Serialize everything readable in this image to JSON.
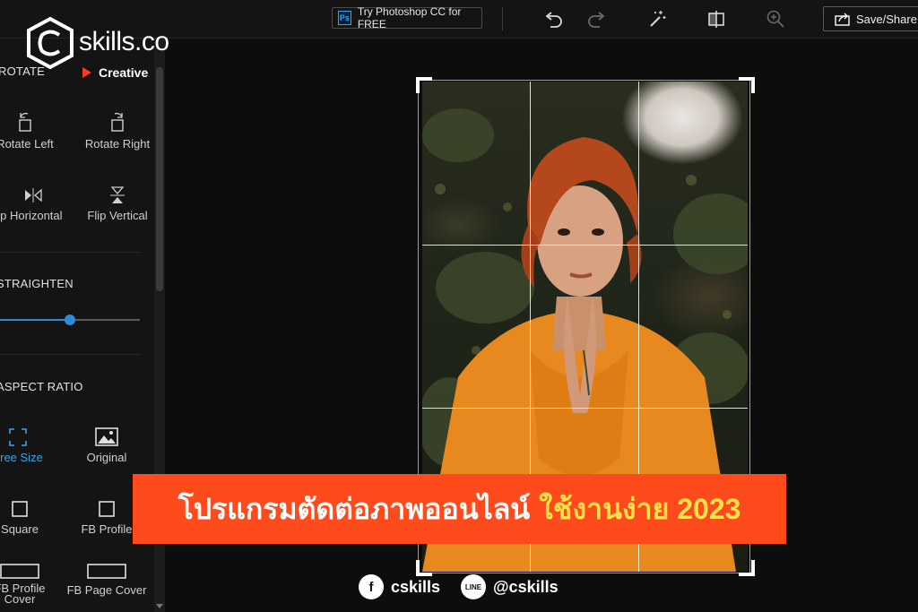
{
  "toolbar": {
    "ps_badge": "Ps",
    "try_photoshop_label": "Try Photoshop CC for FREE",
    "save_label": "Save/Share",
    "icons": [
      "undo-icon",
      "redo-icon",
      "magic-wand-icon",
      "compare-icon",
      "zoom-icon"
    ]
  },
  "brand": {
    "name": "skills.co",
    "sub": "Creative"
  },
  "sidebar": {
    "rotate_title": "ROTATE",
    "rotate_left": "Rotate Left",
    "rotate_right": "Rotate Right",
    "flip_horizontal": "Flip Horizontal",
    "flip_vertical": "Flip Vertical",
    "straighten_title": "STRAIGHTEN",
    "straighten_level": 0.5,
    "aspect_title": "ASPECT RATIO",
    "aspect_items": {
      "free_size": "Free Size",
      "original": "Original",
      "square": "Square",
      "fb_profile": "FB Profile",
      "fb_profile_cover": "FB Profile Cover",
      "fb_page_cover": "FB Page Cover"
    },
    "active_aspect": "Free Size"
  },
  "banner": {
    "text": "โปรแกรมตัดต่อภาพออนไลน์",
    "highlight": "ใช้งานง่าย 2023"
  },
  "social": {
    "facebook": "cskills",
    "line_badge": "LINE",
    "line": "@cskills"
  },
  "colors": {
    "accent": "#2e8bd6",
    "banner": "#ff4a1c",
    "highlight": "#ffe14a"
  }
}
